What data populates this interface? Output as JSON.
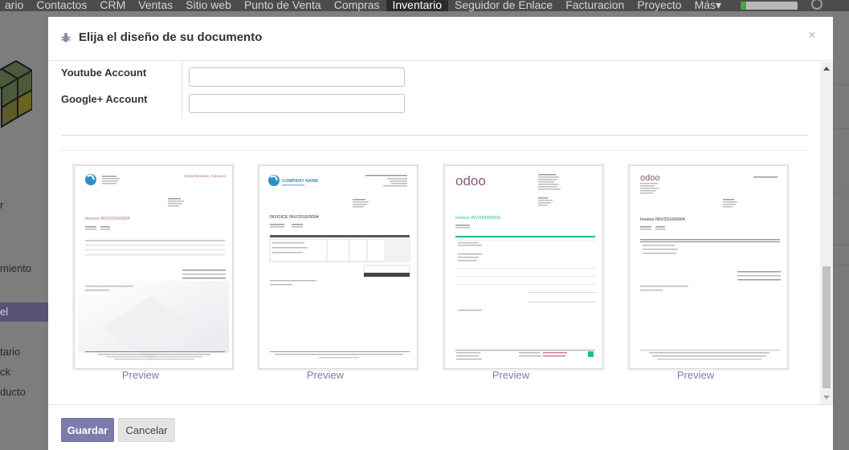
{
  "navbar": {
    "items": [
      "ario",
      "Contactos",
      "CRM",
      "Ventas",
      "Sitio web",
      "Punto de Venta",
      "Compras",
      "Inventario",
      "Seguidor de Enlace",
      "Facturacion",
      "Proyecto",
      "Más▾"
    ],
    "active": "Inventario",
    "progress": 0.1
  },
  "sidebar": {
    "items": [
      "r",
      "miento",
      "el",
      "tario",
      "ck",
      "ducto"
    ]
  },
  "modal": {
    "title": "Elija el diseño de su documento",
    "close_glyph": "×",
    "fields": [
      {
        "label": "Youtube Account",
        "value": ""
      },
      {
        "label": "Google+ Account",
        "value": ""
      }
    ],
    "templates": [
      {
        "name": "Global Business Solutions",
        "invoice": "Invoice INV/2016/0004",
        "preview_label": "Preview"
      },
      {
        "name": "COMPANY NAME",
        "invoice": "INVOICE INV/2016/0004",
        "preview_label": "Preview"
      },
      {
        "name": "odoo",
        "invoice": "Invoice INV/2016/0003",
        "preview_label": "Preview"
      },
      {
        "name": "odoo",
        "invoice": "Invoice INV/2016/0004",
        "preview_label": "Preview"
      }
    ],
    "buttons": {
      "save": "Guardar",
      "cancel": "Cancelar"
    }
  },
  "colors": {
    "primary": "#7c7bad",
    "invoice_accent": "#b06a97",
    "odoo_purple": "#875a7b",
    "odoo_green": "#21b799"
  }
}
